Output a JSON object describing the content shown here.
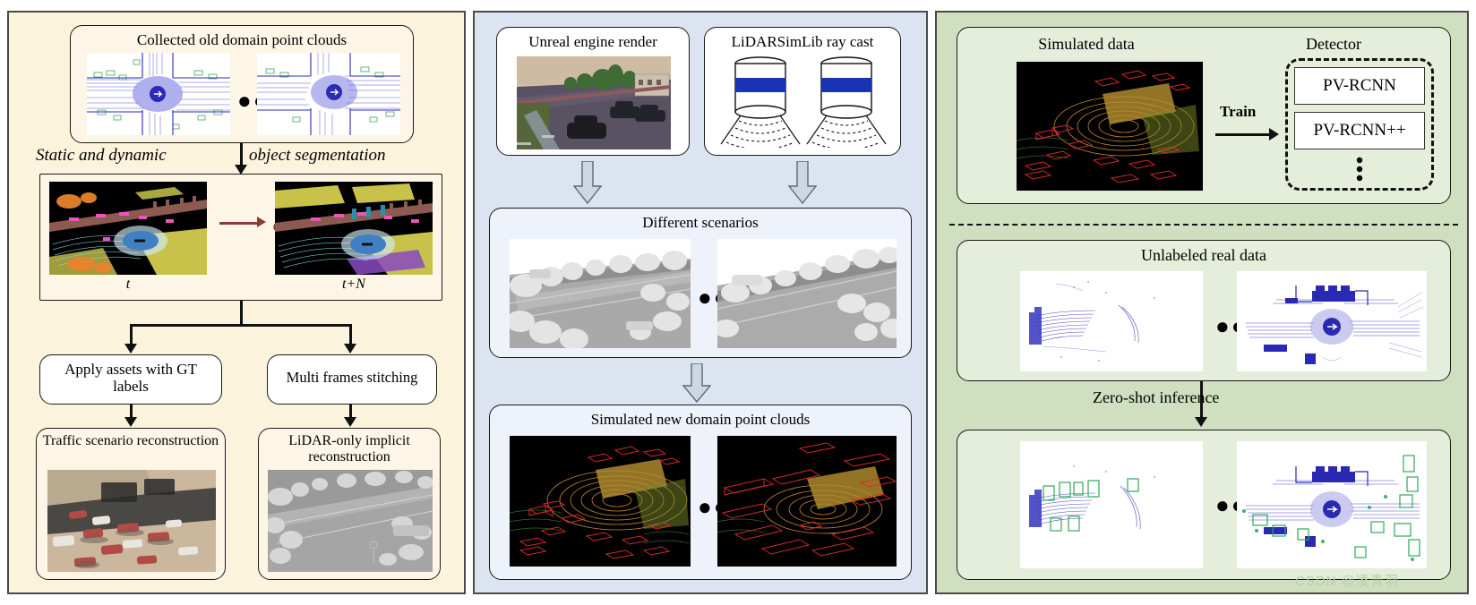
{
  "figure": {
    "watermark": "CSDN @凌青羽",
    "colors": {
      "left_panel_bg": "#fcf3dd",
      "mid_panel_bg": "#dce4f2",
      "right_panel_bg": "#cfdfc0",
      "card_cream": "#fdf6e7",
      "card_blue": "#eef2fa",
      "card_green": "#e4eeda",
      "stroke": "#1a1a1a",
      "arrow_red": "#8c3b32",
      "lidar_blue": "#1833b5"
    }
  },
  "left_panel": {
    "collected": {
      "title": "Collected old domain point clouds",
      "ellipsis": "●●●"
    },
    "segmentation_label": {
      "before": "Static and dynamic",
      "after": "object segmentation"
    },
    "frames": {
      "left_caption": "t",
      "right_caption": "t+N",
      "ellipsis": "●●●"
    },
    "branch_left": {
      "label": "Apply assets with GT labels"
    },
    "branch_right": {
      "label": "Multi frames stitching"
    },
    "result_left": {
      "title": "Traffic scenario reconstruction"
    },
    "result_right": {
      "title": "LiDAR-only implicit reconstruction"
    }
  },
  "mid_panel": {
    "unreal": {
      "title": "Unreal engine render"
    },
    "raycast": {
      "title": "LiDARSimLib ray cast"
    },
    "scenarios": {
      "title": "Different scenarios",
      "ellipsis": "●●●"
    },
    "simulated": {
      "title": "Simulated new domain point clouds",
      "ellipsis": "●●●"
    }
  },
  "right_panel": {
    "train_block": {
      "sim_title": "Simulated data",
      "detector_title": "Detector",
      "train_label": "Train",
      "detectors": [
        "PV-RCNN",
        "PV-RCNN++"
      ],
      "more_indicator": "⠇"
    },
    "unlabeled": {
      "title": "Unlabeled real data",
      "ellipsis": "●●●"
    },
    "inference_label": "Zero-shot inference",
    "inference_result": {
      "ellipsis": "●●●"
    }
  }
}
